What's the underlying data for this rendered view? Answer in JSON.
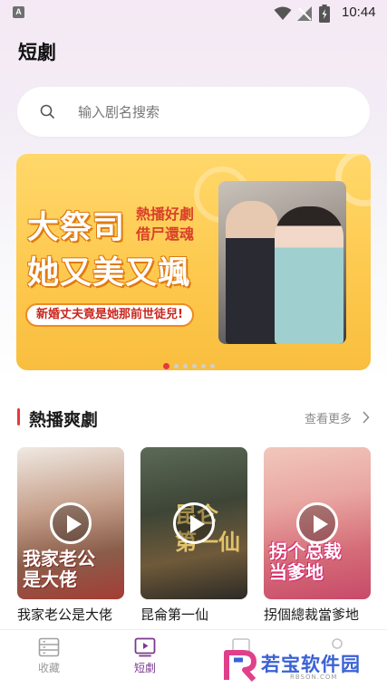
{
  "status_bar": {
    "time": "10:44"
  },
  "page": {
    "title": "短劇"
  },
  "search": {
    "placeholder": "输入剧名搜索"
  },
  "banner": {
    "headline_line1": "大祭司",
    "headline_line2": "她又美又颯",
    "tag_line1": "熱播好劇",
    "tag_line2": "借尸還魂",
    "subtitle": "新婚丈夫竟是她那前世徒兒!",
    "slide_count": 6,
    "active_slide": 1
  },
  "section": {
    "title": "熱播爽劇",
    "more_label": "查看更多"
  },
  "dramas": [
    {
      "title": "我家老公是大佬",
      "poster_text_line1": "我家老公",
      "poster_text_line2": "是大佬"
    },
    {
      "title": "昆侖第一仙",
      "poster_text_line1": "昆仑",
      "poster_text_line2": "第一仙"
    },
    {
      "title": "拐個總裁當爹地",
      "poster_text_line1": "拐个总裁",
      "poster_text_line2": "当爹地"
    }
  ],
  "tabs": [
    {
      "label": "收藏",
      "icon": "bookmark-list-icon",
      "active": false
    },
    {
      "label": "短劇",
      "icon": "play-tv-icon",
      "active": true
    }
  ],
  "watermark": {
    "text": "若宝软件园",
    "url": "RBSON.COM"
  },
  "colors": {
    "accent": "#e8383d",
    "active_tab": "#7b3a8e",
    "banner_bg": "#fdc94e"
  }
}
